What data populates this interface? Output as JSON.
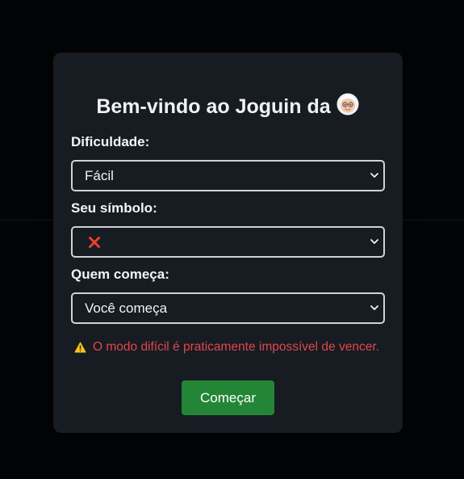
{
  "modal": {
    "title": "Bem-vindo ao Joguin da",
    "title_icon": "old-person-emoji-icon"
  },
  "form": {
    "difficulty": {
      "label": "Dificuldade:",
      "selected": "Fácil"
    },
    "symbol": {
      "label": "Seu símbolo:",
      "selected_icon": "red-x-icon"
    },
    "starter": {
      "label": "Quem começa:",
      "selected": "Você começa"
    }
  },
  "warning": {
    "icon": "warning-icon",
    "text": "O modo difícil é praticamente impossível de vencer."
  },
  "actions": {
    "start_label": "Começar"
  },
  "colors": {
    "page_bg": "#030405",
    "modal_bg": "#171b22",
    "text": "#f2f4f7",
    "warning_text": "#e0464c",
    "button_bg": "#238636",
    "select_border": "#cfd3d9"
  }
}
